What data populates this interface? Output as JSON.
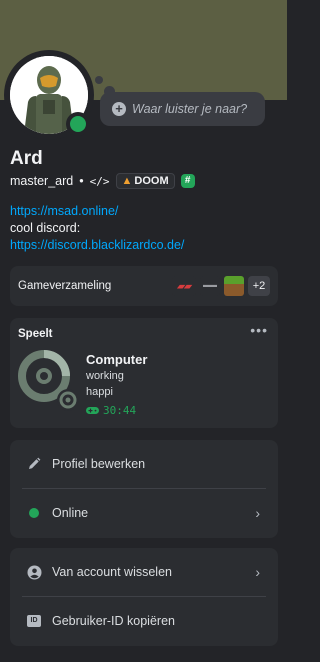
{
  "status_bubble": {
    "placeholder": "Waar luister je naar?"
  },
  "profile": {
    "display_name": "Ard",
    "username": "master_ard",
    "separator": "•",
    "code_badge": "</>",
    "clan_tag": "DOOM",
    "bio_lines": [
      {
        "text": "https://msad.online/",
        "kind": "link"
      },
      {
        "text": "cool discord:",
        "kind": "text"
      },
      {
        "text": "https://discord.blacklizardco.de/",
        "kind": "link"
      }
    ]
  },
  "games": {
    "title": "Gameverzameling",
    "thumbnails": [
      "game-logo-red",
      "game-logo-grey",
      "minecraft-block"
    ],
    "more_count": "+2"
  },
  "activity": {
    "label": "Speelt",
    "more_icon": "more-dots-icon",
    "name": "Computer",
    "details": "working",
    "state": "happi",
    "elapsed": "30:44"
  },
  "menu_primary": [
    {
      "label": "Profiel bewerken",
      "icon": "pencil-icon",
      "chevron": false
    },
    {
      "label": "Online",
      "icon": "online-status-icon",
      "chevron": true
    }
  ],
  "menu_secondary": [
    {
      "label": "Van account wisselen",
      "icon": "account-icon",
      "chevron": true
    },
    {
      "label": "Gebruiker-ID kopiëren",
      "icon": "id-icon",
      "chevron": false
    }
  ],
  "colors": {
    "banner": "#5c5f43",
    "background": "#232428",
    "card": "#2b2d31",
    "online": "#23a559",
    "link": "#00a8fc"
  }
}
